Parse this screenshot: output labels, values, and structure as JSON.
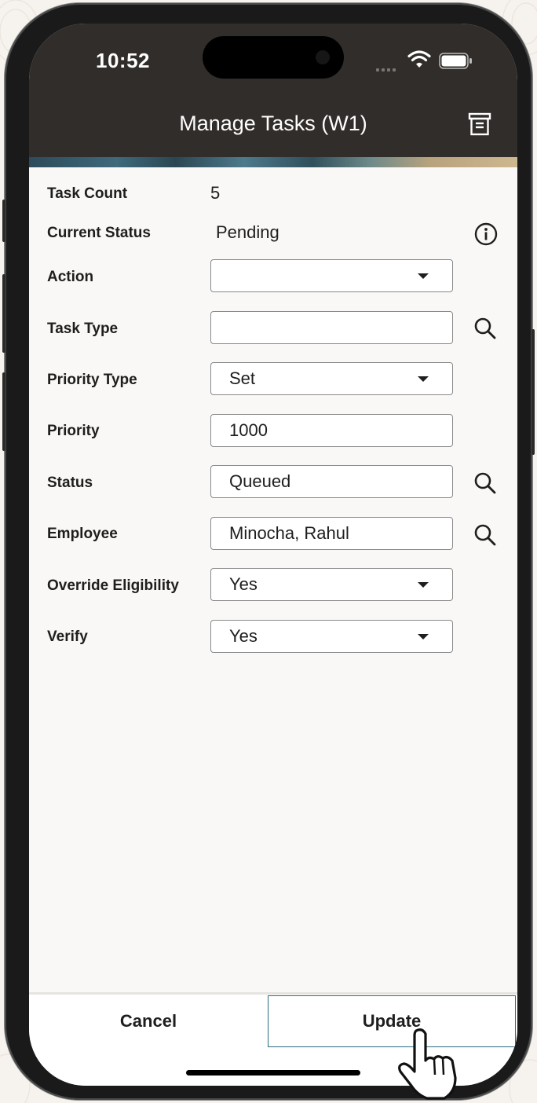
{
  "status_bar": {
    "time": "10:52"
  },
  "header": {
    "title": "Manage Tasks (W1)",
    "menu_icon": "filing-cabinet-icon"
  },
  "form": {
    "task_count": {
      "label": "Task Count",
      "value": "5"
    },
    "current_status": {
      "label": "Current Status",
      "value": "Pending",
      "icon": "info-icon"
    },
    "action": {
      "label": "Action",
      "value": ""
    },
    "task_type": {
      "label": "Task Type",
      "value": "",
      "icon": "search-icon"
    },
    "priority_type": {
      "label": "Priority Type",
      "value": "Set"
    },
    "priority": {
      "label": "Priority",
      "value": "1000"
    },
    "status": {
      "label": "Status",
      "value": "Queued",
      "icon": "search-icon"
    },
    "employee": {
      "label": "Employee",
      "value": "Minocha, Rahul",
      "icon": "search-icon"
    },
    "override_eligibility": {
      "label": "Override Eligibility",
      "value": "Yes"
    },
    "verify": {
      "label": "Verify",
      "value": "Yes"
    }
  },
  "footer": {
    "cancel_label": "Cancel",
    "update_label": "Update"
  },
  "colors": {
    "header_bg": "#312d2a",
    "accent_border": "#2c6c7f",
    "content_bg": "#f9f8f6"
  }
}
